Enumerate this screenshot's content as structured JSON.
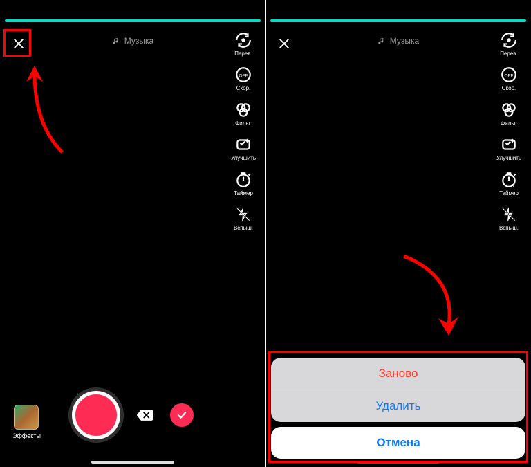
{
  "left": {
    "music_label": "Музыка",
    "tools": {
      "flip": "Перев.",
      "speed": "Скор.",
      "filter": "Фильт.",
      "beautify": "Улучшить",
      "timer": "Таймер",
      "flash": "Вспыш."
    },
    "effects_label": "Эффекты"
  },
  "right": {
    "music_label": "Музыка",
    "tools": {
      "flip": "Перев.",
      "speed": "Скор.",
      "filter": "Фильт.",
      "beautify": "Улучшить",
      "timer": "Таймер",
      "flash": "Вспыш."
    },
    "sheet": {
      "restart": "Заново",
      "delete": "Удалить",
      "cancel": "Отмена"
    }
  }
}
